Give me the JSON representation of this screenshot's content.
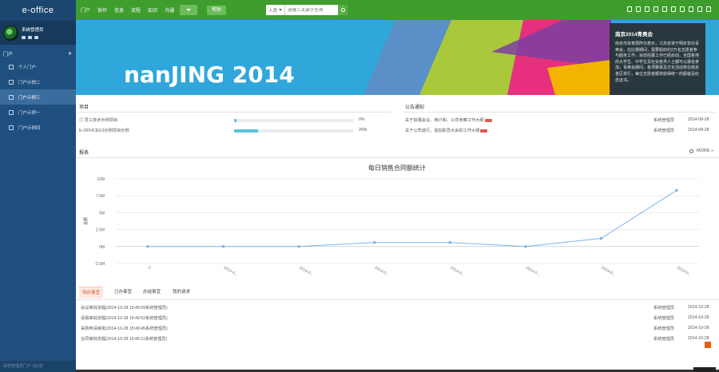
{
  "app": {
    "logo": "e-office"
  },
  "user": {
    "name": "系统管理员"
  },
  "sidebar": {
    "section": "门户",
    "items": [
      {
        "label": "个人门户"
      },
      {
        "label": "门户示例二"
      },
      {
        "label": "门户示例三"
      },
      {
        "label": "门户示例一"
      },
      {
        "label": "门户示例四"
      }
    ],
    "active_index": 2,
    "footer": "系统管理员门户 (在线)"
  },
  "topbar": {
    "menu": [
      "门户",
      "协作",
      "信息",
      "流程",
      "知识",
      "沟通"
    ],
    "help_label": "帮助",
    "search": {
      "scope": "人员",
      "placeholder": "请输入关键字查询"
    },
    "tools": [
      "document-icon",
      "cloud-icon",
      "search-icon",
      "external-link-icon",
      "calendar-icon",
      "clock-icon",
      "location-icon",
      "user-icon",
      "gear-icon",
      "power-icon"
    ]
  },
  "banner": {
    "art_text": "nanJING 2014",
    "title": "南京2014青奥会",
    "desc": "南京市体育局昨日表示，江苏省将于明年举办青奥会，在比赛期间，需要组织约2万名志愿者参与服务工作，目前招募工作已经启动，全国各地的大学生、中学生及社会各界人士都可以报名参加，青奥会期间，各项赛事及文化活动将在南京各区举行，每位志愿者都将获得统一的服装及纪念证书。"
  },
  "plan_panel": {
    "title": "项目",
    "rows": [
      {
        "name": "◎ 员工技术示例项目",
        "progress": 0.02,
        "percent": "0%"
      },
      {
        "name": "E-OFFICE9.0示例项目示例",
        "progress": 0.2,
        "percent": "20%"
      }
    ]
  },
  "news_panel": {
    "title": "公告通知",
    "rows": [
      {
        "title": "关于加强会议、用户和、公司考察工作大纲",
        "author": "系统管理员",
        "date": "2014-08-28"
      },
      {
        "title": "关于公司进行、追加职员大会的工作大纲",
        "author": "系统管理员",
        "date": "2014-08-28"
      }
    ]
  },
  "chart_panel": {
    "title": "报表",
    "more": "MORE »"
  },
  "chart_data": {
    "type": "line",
    "title": "每日销售合同额统计",
    "ylabel": "金额",
    "ylim": [
      -2.5,
      10
    ],
    "yticks": [
      "10M",
      "7.5M",
      "5M",
      "2.5M",
      "0M",
      "-2.5M"
    ],
    "categories": [
      "0",
      "2014-0...",
      "2014-0...",
      "2014-0...",
      "2014-0...",
      "2014-0...",
      "2014-0...",
      "2014-0..."
    ],
    "series": [
      {
        "values": [
          0,
          0,
          0,
          0.6,
          0.6,
          0,
          1.2,
          8.3
        ]
      }
    ],
    "grid": true
  },
  "tasks": {
    "tabs": [
      "待办事宜",
      "已办事宜",
      "办结事宜",
      "我的请求"
    ],
    "active_tab": 0,
    "rows": [
      {
        "title": "会议审批流程(2014-10-28 15:49:59系统管理员)",
        "author": "系统管理员",
        "date": "2014-10-28"
      },
      {
        "title": "请假审批流程(2014-10-28 15:49:52系统管理员)",
        "author": "系统管理员",
        "date": "2014-10-28"
      },
      {
        "title": "采购申请审批(2014-10-28 15:49:45系统管理员)",
        "author": "系统管理员",
        "date": "2014-10-28"
      },
      {
        "title": "合同审批流程(2014-10-28 15:46:11系统管理员)",
        "author": "系统管理员",
        "date": "2014-10-28"
      }
    ]
  },
  "colors": {
    "sidebar": "#1f4f7f",
    "topbar": "#3f9d2e",
    "accent": "#5bc0de",
    "active_tab": "#d2562b"
  }
}
